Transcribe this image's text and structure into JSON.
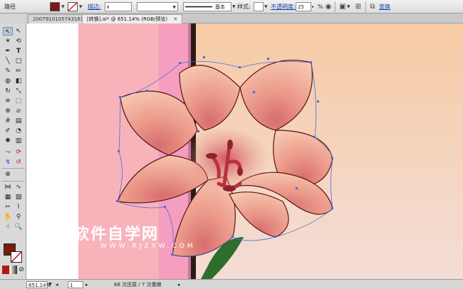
{
  "control_bar": {
    "object_type": "路径",
    "fill_color": "#7a1a10",
    "stroke_label": "描边:",
    "stroke_profile": "基本",
    "style_label": "样式:",
    "opacity_label": "不透明度:",
    "opacity_value": "25",
    "opacity_unit": "%",
    "transform_label": "变换"
  },
  "tabs": [
    {
      "label": "2007910105743161"
    },
    {
      "label": "[转换].ai* @ 651.14% (RGB/预览)"
    }
  ],
  "status_bar": {
    "zoom": "651.14%",
    "page": "1",
    "history": "68 次还原 / 7 次重做"
  },
  "watermark": {
    "title": "软件自学网",
    "url": "WWW.RJZXW.COM"
  },
  "colors": {
    "pink_band": "#f8b3ba",
    "magenta_band": "#f59ebf",
    "dark_bar": "#2b1a14",
    "sky_top": "#f6cba5",
    "sky_bottom": "#f4ddd6",
    "petal_light": "#f6c9b1",
    "petal_mid": "#ec9a8a",
    "petal_center": "#d66d6f",
    "stamen": "#b8323c",
    "outline": "#5b1212",
    "anchor": "#4a6ae0",
    "leaf": "#2e6e2c",
    "tool_fill": "#7a1a10"
  },
  "icons": {
    "stroke_swatch": "no-stroke-icon",
    "selection_tool": "selection-arrow-icon",
    "recolor": "recolor-icon",
    "align": "align-icon"
  }
}
